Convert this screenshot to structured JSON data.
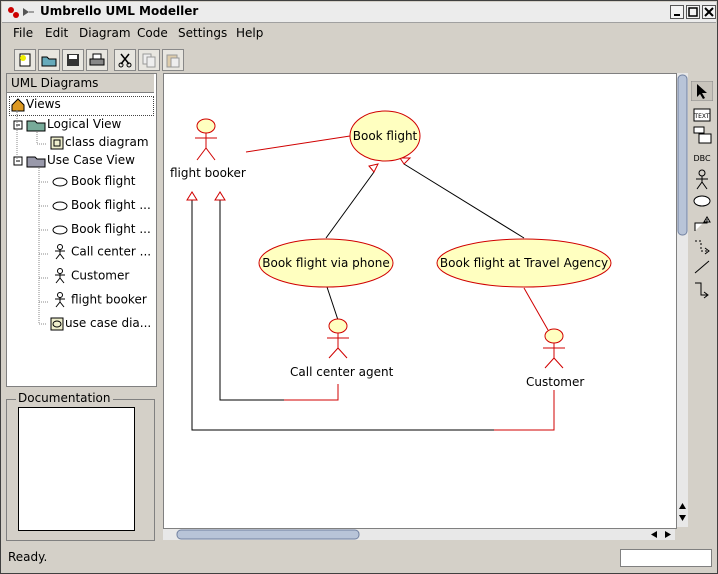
{
  "window": {
    "title": "Umbrello UML Modeller"
  },
  "menu": [
    "File",
    "Edit",
    "Diagram",
    "Code",
    "Settings",
    "Help"
  ],
  "toolbar": {
    "icons": [
      "new-icon",
      "open-icon",
      "save-icon",
      "print-icon",
      "cut-icon",
      "copy-icon",
      "paste-icon"
    ]
  },
  "tree": {
    "header": "UML Diagrams",
    "root": "Views",
    "logical_view": "Logical View",
    "class_diagram": "class diagram",
    "use_case_view": "Use Case View",
    "items": [
      "Book flight",
      "Book flight ...",
      "Book flight ...",
      "Call center ...",
      "Customer",
      "flight booker",
      "use case dia..."
    ]
  },
  "documentation": {
    "label": "Documentation"
  },
  "diagram": {
    "actors": [
      "flight booker",
      "Call center agent",
      "Customer"
    ],
    "use_cases": [
      "Book flight",
      "Book flight via phone",
      "Book flight at Travel Agency"
    ],
    "colors": {
      "stroke": "#d00000",
      "fill": "#ffffc0",
      "line": "#000000"
    }
  },
  "right_toolbar": {
    "labels": [
      "TEXT",
      "DBC"
    ]
  },
  "status": {
    "text": "Ready."
  }
}
